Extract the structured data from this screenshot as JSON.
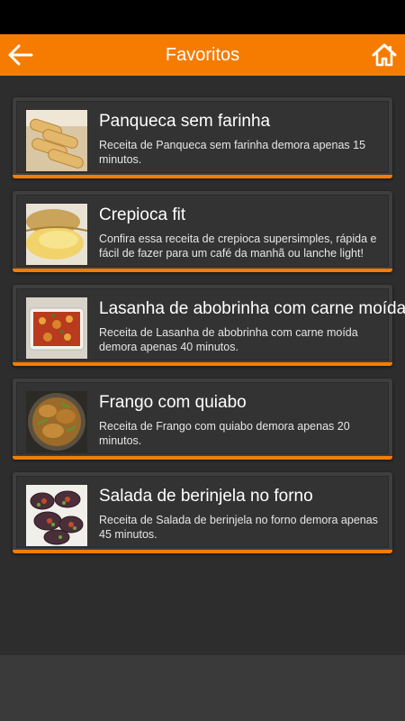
{
  "app_bar": {
    "title": "Favoritos",
    "back_icon": "arrow-left-icon",
    "home_icon": "home-icon",
    "color": "#f57c00"
  },
  "recipes": [
    {
      "title": "Panqueca sem farinha",
      "description": "Receita de Panqueca sem farinha demora apenas 15 minutos.",
      "image": "pancake-rolls-photo"
    },
    {
      "title": "Crepioca fit",
      "description": "Confira essa receita de crepioca supersimples, rápida e fácil de fazer para um café da manhã ou lanche light!",
      "image": "crepioca-photo"
    },
    {
      "title": "Lasanha de abobrinha com carne moída",
      "description": "Receita de Lasanha de abobrinha com carne moída demora apenas 40 minutos.",
      "image": "zucchini-lasagna-photo"
    },
    {
      "title": "Frango com quiabo",
      "description": "Receita de Frango com quiabo demora apenas 20 minutos.",
      "image": "chicken-okra-photo"
    },
    {
      "title": "Salada de berinjela no forno",
      "description": "Receita de Salada de berinjela no forno demora apenas 45 minutos.",
      "image": "eggplant-salad-photo"
    }
  ]
}
